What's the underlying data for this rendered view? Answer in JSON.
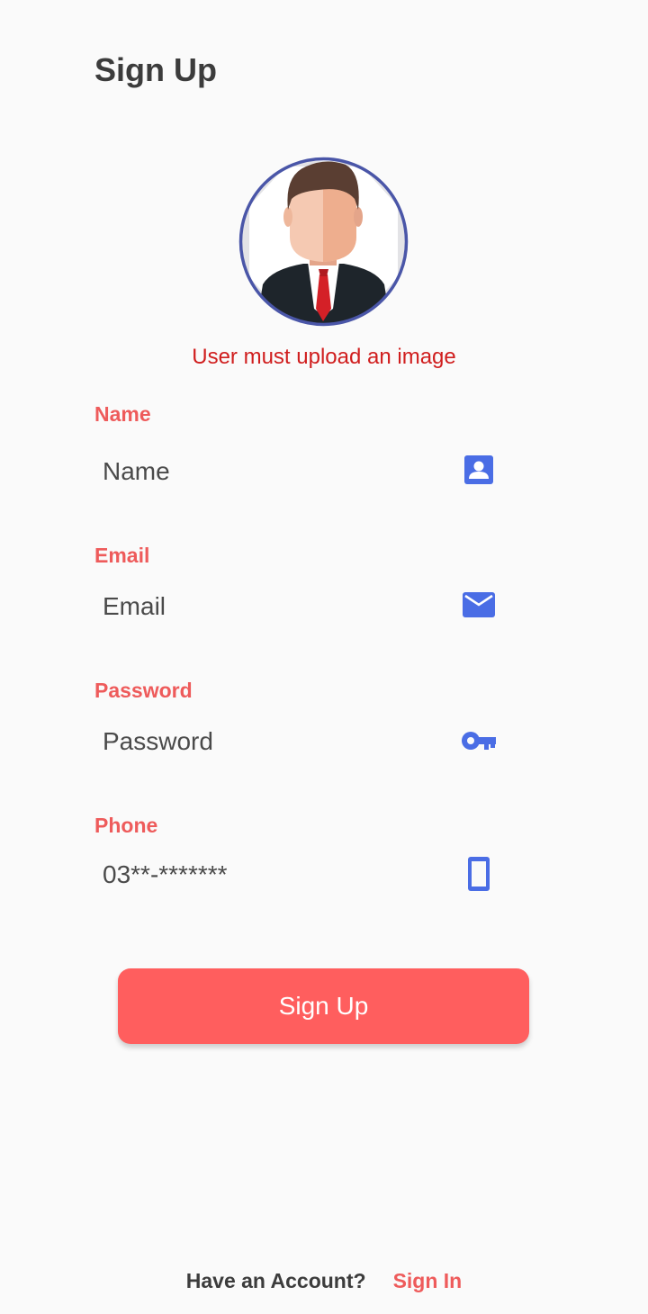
{
  "header": {
    "title": "Sign Up"
  },
  "avatar": {
    "error_text": "User must upload an image"
  },
  "fields": {
    "name": {
      "label": "Name",
      "placeholder": "Name",
      "icon": "contact-card-icon"
    },
    "email": {
      "label": "Email",
      "placeholder": "Email",
      "icon": "mail-icon"
    },
    "password": {
      "label": "Password",
      "placeholder": "Password",
      "icon": "key-icon"
    },
    "phone": {
      "label": "Phone",
      "placeholder": "03**-*******",
      "icon": "phone-icon"
    }
  },
  "actions": {
    "signup_label": "Sign Up"
  },
  "footer": {
    "prompt": "Have an Account?",
    "signin_label": "Sign In"
  },
  "colors": {
    "accent": "#ff5e5e",
    "label": "#ee5b5b",
    "error": "#d01e1e",
    "icon": "#4a6de5",
    "avatar_border": "#4a56a8"
  }
}
